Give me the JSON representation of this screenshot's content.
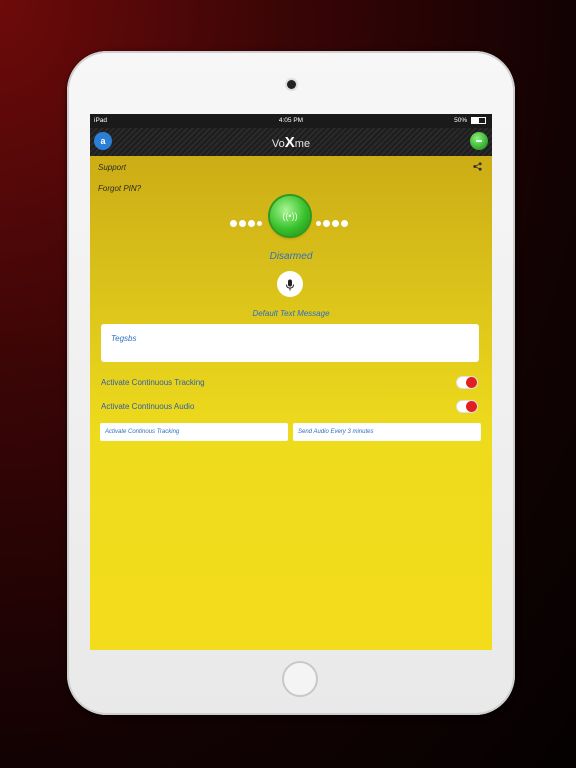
{
  "status": {
    "carrier": "iPad",
    "time": "4:05 PM",
    "battery": "50%"
  },
  "nav": {
    "left_icon_label": "a",
    "title_left": "Vo",
    "title_x": "X",
    "title_right": "me"
  },
  "support_label": "Support",
  "forgot_pin_label": "Forgot PIN?",
  "arm_status": "Disarmed",
  "default_message_label": "Default Text Message",
  "default_message_value": "Tegsbs",
  "tracking_label": "Activate Continuous Tracking",
  "tracking_on": false,
  "audio_label": "Activate Continuous Audio",
  "audio_on": false,
  "tracking_field": "Activate Continous Tracking",
  "audio_field": "Send Audio Every 3 minutes",
  "colors": {
    "accent": "#2e6fc2",
    "toggle_red": "#e02020",
    "arm_green": "#37c12c"
  }
}
